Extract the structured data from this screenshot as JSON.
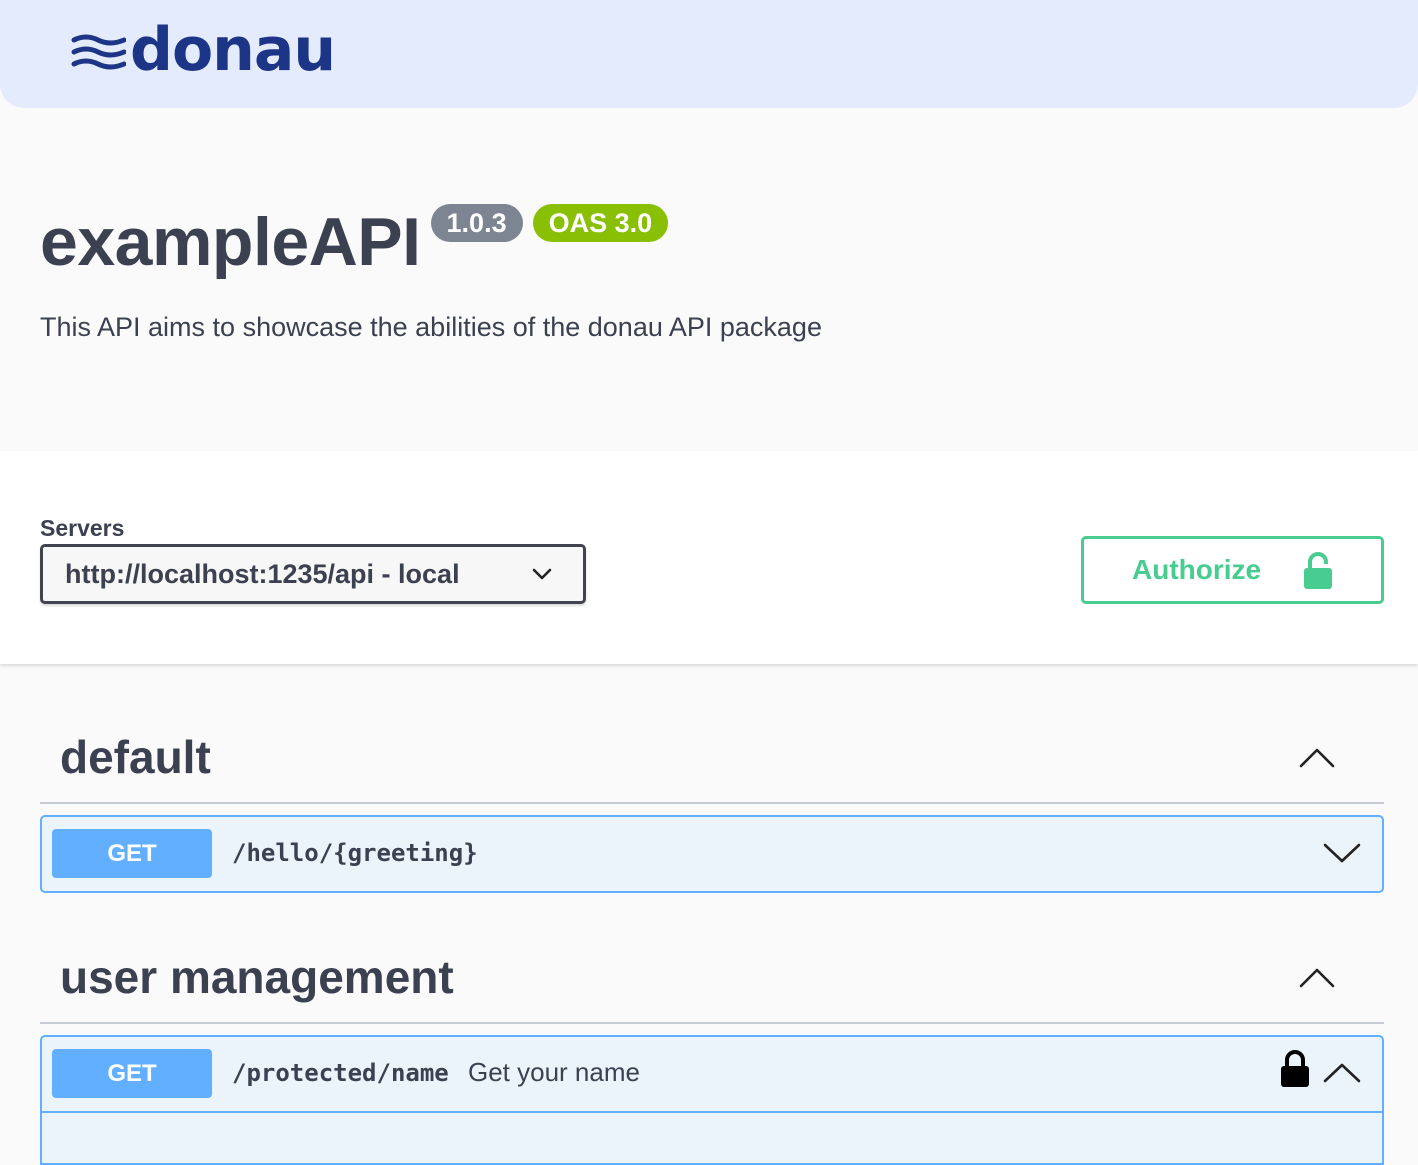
{
  "topbar": {
    "logo_text": "donau",
    "logo_icon": "wave-lines-icon"
  },
  "info": {
    "title": "exampleAPI",
    "version": "1.0.3",
    "oas_version": "OAS 3.0",
    "description": "This API aims to showcase the abilities of the donau API package"
  },
  "servers": {
    "label": "Servers",
    "selected": "http://localhost:1235/api - local"
  },
  "authorize": {
    "label": "Authorize",
    "icon": "unlocked-padlock-icon"
  },
  "tags": [
    {
      "name": "default",
      "expanded": true,
      "operations": [
        {
          "method": "GET",
          "path": "/hello/{greeting}",
          "summary": "",
          "locked": false,
          "expanded": false
        }
      ]
    },
    {
      "name": "user management",
      "expanded": true,
      "operations": [
        {
          "method": "GET",
          "path": "/protected/name",
          "summary": "Get your name",
          "locked": true,
          "expanded": true
        }
      ]
    }
  ],
  "colors": {
    "topbar_bg": "#e3ebfc",
    "logo": "#1c3586",
    "version_badge": "#7d8492",
    "oas_badge": "#89bf04",
    "authorize": "#49cc90",
    "get_method": "#61affe",
    "get_bg": "#ebf3fb"
  }
}
